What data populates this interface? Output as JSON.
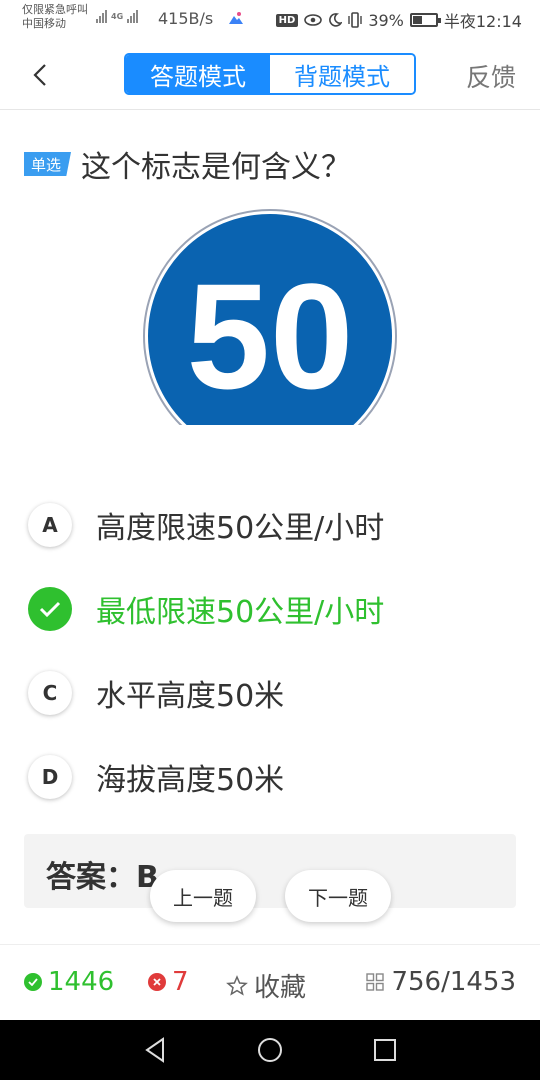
{
  "status_bar": {
    "carrier_line1": "仅限紧急呼叫",
    "carrier_line2": "中国移动",
    "net_type": "4G",
    "speed": "415B/s",
    "battery_percent": "39%",
    "battery_level": 0.39,
    "time": "半夜12:14",
    "hd_label": "HD"
  },
  "header": {
    "back_icon": "chevron-left-icon",
    "tabs": [
      {
        "label": "答题模式",
        "active": true
      },
      {
        "label": "背题模式",
        "active": false
      }
    ],
    "feedback_label": "反馈"
  },
  "question": {
    "type_label": "单选",
    "text": "这个标志是何含义？",
    "sign_number": "50"
  },
  "options": [
    {
      "letter": "A",
      "text": "高度限速50公里/小时",
      "state": "normal"
    },
    {
      "letter": "B",
      "text": "最低限速50公里/小时",
      "state": "correct"
    },
    {
      "letter": "C",
      "text": "水平高度50米",
      "state": "normal"
    },
    {
      "letter": "D",
      "text": "海拔高度50米",
      "state": "normal"
    }
  ],
  "answer": {
    "text": "答案：B"
  },
  "nav": {
    "prev_label": "上一题",
    "next_label": "下一题"
  },
  "bottom_bar": {
    "correct_count": "1446",
    "wrong_count": "7",
    "favorite_label": "收藏",
    "progress": "756/1453"
  },
  "colors": {
    "accent": "#1a8cff",
    "correct": "#2fc02f",
    "wrong": "#e03b3b",
    "sign_blue": "#0a63b0"
  }
}
